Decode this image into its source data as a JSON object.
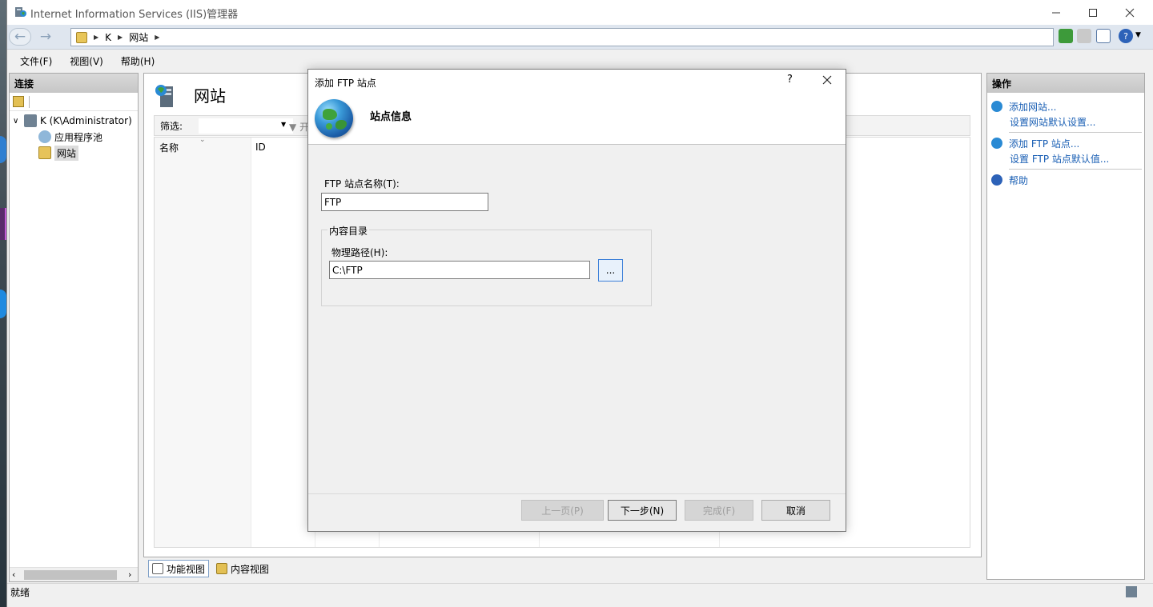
{
  "window": {
    "title": "Internet Information Services (IIS)管理器"
  },
  "address": {
    "crumbs": [
      "K",
      "网站"
    ]
  },
  "menu": {
    "file": "文件(F)",
    "view": "视图(V)",
    "help": "帮助(H)"
  },
  "connections": {
    "header": "连接",
    "server": "K (K\\Administrator)",
    "app_pools": "应用程序池",
    "sites": "网站"
  },
  "center": {
    "title": "网站",
    "filter_label": "筛选:",
    "filter_go": "开",
    "columns": [
      "名称",
      "ID"
    ]
  },
  "view_tabs": {
    "features": "功能视图",
    "content": "内容视图"
  },
  "actions": {
    "header": "操作",
    "add_site": "添加网站...",
    "site_defaults": "设置网站默认设置...",
    "add_ftp": "添加 FTP 站点...",
    "ftp_defaults": "设置 FTP 站点默认值...",
    "help": "帮助"
  },
  "status": {
    "text": "就绪"
  },
  "dialog": {
    "title": "添加 FTP 站点",
    "help_glyph": "?",
    "heading": "站点信息",
    "site_name_label": "FTP 站点名称(T):",
    "site_name_value": "FTP",
    "content_dir_legend": "内容目录",
    "physical_path_label": "物理路径(H):",
    "physical_path_value": "C:\\FTP",
    "browse_label": "...",
    "prev_button": "上一页(P)",
    "next_button": "下一步(N)",
    "finish_button": "完成(F)",
    "cancel_button": "取消"
  }
}
